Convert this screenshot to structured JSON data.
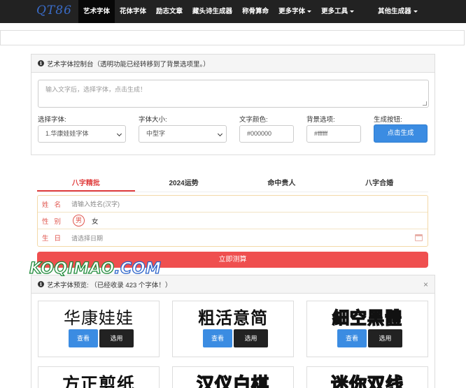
{
  "nav": {
    "brand": "QT86",
    "items": [
      {
        "label": "艺术字体",
        "active": true,
        "dropdown": false
      },
      {
        "label": "花体字体",
        "active": false,
        "dropdown": false
      },
      {
        "label": "励志文章",
        "active": false,
        "dropdown": false
      },
      {
        "label": "藏头诗生成器",
        "active": false,
        "dropdown": false
      },
      {
        "label": "称骨算命",
        "active": false,
        "dropdown": false
      },
      {
        "label": "更多字体",
        "active": false,
        "dropdown": true
      },
      {
        "label": "更多工具",
        "active": false,
        "dropdown": true
      },
      {
        "label": "其他生成器",
        "active": false,
        "dropdown": true
      }
    ]
  },
  "console": {
    "title": "艺术字体控制台（透明功能已经转移到了背景选项里。）",
    "textarea_placeholder": "输入文字后，选择字体，点击生成！",
    "font_label": "选择字体:",
    "font_value": "1.华康娃娃字体",
    "size_label": "字体大小:",
    "size_value": "中型字",
    "color_label": "文字颜色:",
    "color_value": "#000000",
    "bg_label": "背景选项:",
    "bg_value": "#ffffff",
    "button_label": "生成按钮:",
    "button_text": "点击生成"
  },
  "bazi": {
    "tabs": [
      {
        "label": "八字精批",
        "active": true
      },
      {
        "label": "2024运势",
        "active": false
      },
      {
        "label": "命中贵人",
        "active": false
      },
      {
        "label": "八字合婚",
        "active": false
      }
    ],
    "name_label": "姓名",
    "name_placeholder": "请输入姓名(汉字)",
    "gender_label": "性别",
    "gender_male": "男",
    "gender_female": "女",
    "gender_selected": "男",
    "date_label": "生日",
    "date_placeholder": "请选择日期",
    "submit": "立即测算"
  },
  "watermark": {
    "part1": "KOQIMAO",
    "part2": ".COM"
  },
  "preview": {
    "title": "艺术字体预览: （已经收录 423 个字体！）",
    "close": "×",
    "view_label": "查看",
    "select_label": "选用",
    "fonts": [
      {
        "sample": "华康娃娃"
      },
      {
        "sample": "粗活意简"
      },
      {
        "sample": "細空黑體"
      },
      {
        "sample": "方正剪纸"
      },
      {
        "sample": "汉仪白棋"
      },
      {
        "sample": "迷你双线"
      }
    ]
  },
  "colors": {
    "nav_bg": "#222222",
    "brand": "#3a6cc8",
    "primary": "#3b8ce2",
    "danger": "#ef4f4f",
    "accent_red": "#e03e3e"
  }
}
